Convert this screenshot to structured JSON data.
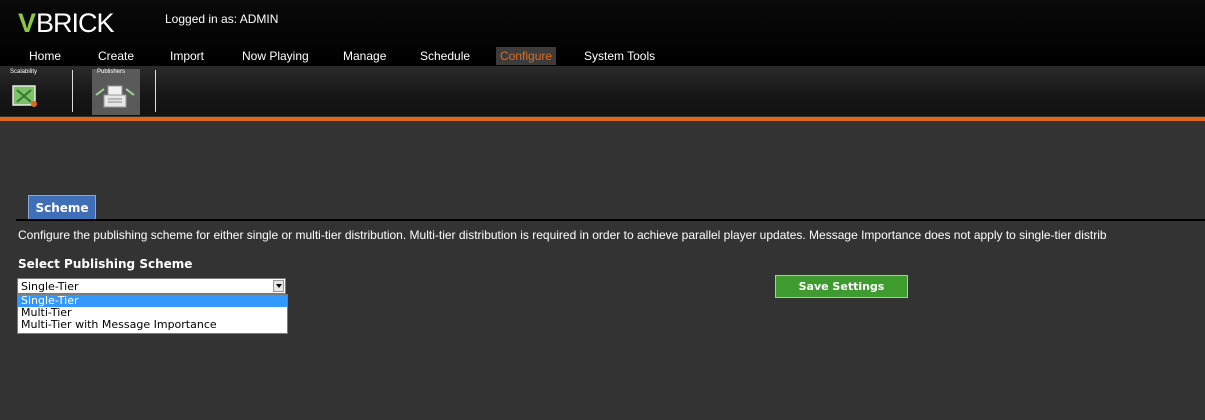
{
  "header": {
    "logo_text": "VBRICK",
    "logged_in": "Logged in as: ADMIN"
  },
  "nav": {
    "items": [
      {
        "label": "Home"
      },
      {
        "label": "Create"
      },
      {
        "label": "Import"
      },
      {
        "label": "Now Playing"
      },
      {
        "label": "Manage"
      },
      {
        "label": "Schedule"
      },
      {
        "label": "Configure",
        "active": true
      },
      {
        "label": "System Tools"
      }
    ]
  },
  "subnav": {
    "items": [
      {
        "label": "Scalability",
        "icon": "scalability-icon"
      },
      {
        "label": "Publishers",
        "icon": "publishers-icon",
        "active": true
      }
    ]
  },
  "tabs": [
    {
      "label": "Scheme"
    }
  ],
  "main": {
    "description": "Configure the publishing scheme for either single or multi-tier distribution. Multi-tier distribution is required in order to achieve parallel player updates. Message Importance does not apply to single-tier distrib",
    "scheme_label": "Select Publishing Scheme",
    "scheme_value": "Single-Tier",
    "scheme_options": [
      "Single-Tier",
      "Multi-Tier",
      "Multi-Tier with Message Importance"
    ],
    "save_label": "Save Settings"
  },
  "colors": {
    "accent_orange": "#e0661c",
    "tab_blue": "#3f6fb8",
    "save_green": "#3e9c2e",
    "background": "#333333",
    "selection": "#3399ff"
  }
}
